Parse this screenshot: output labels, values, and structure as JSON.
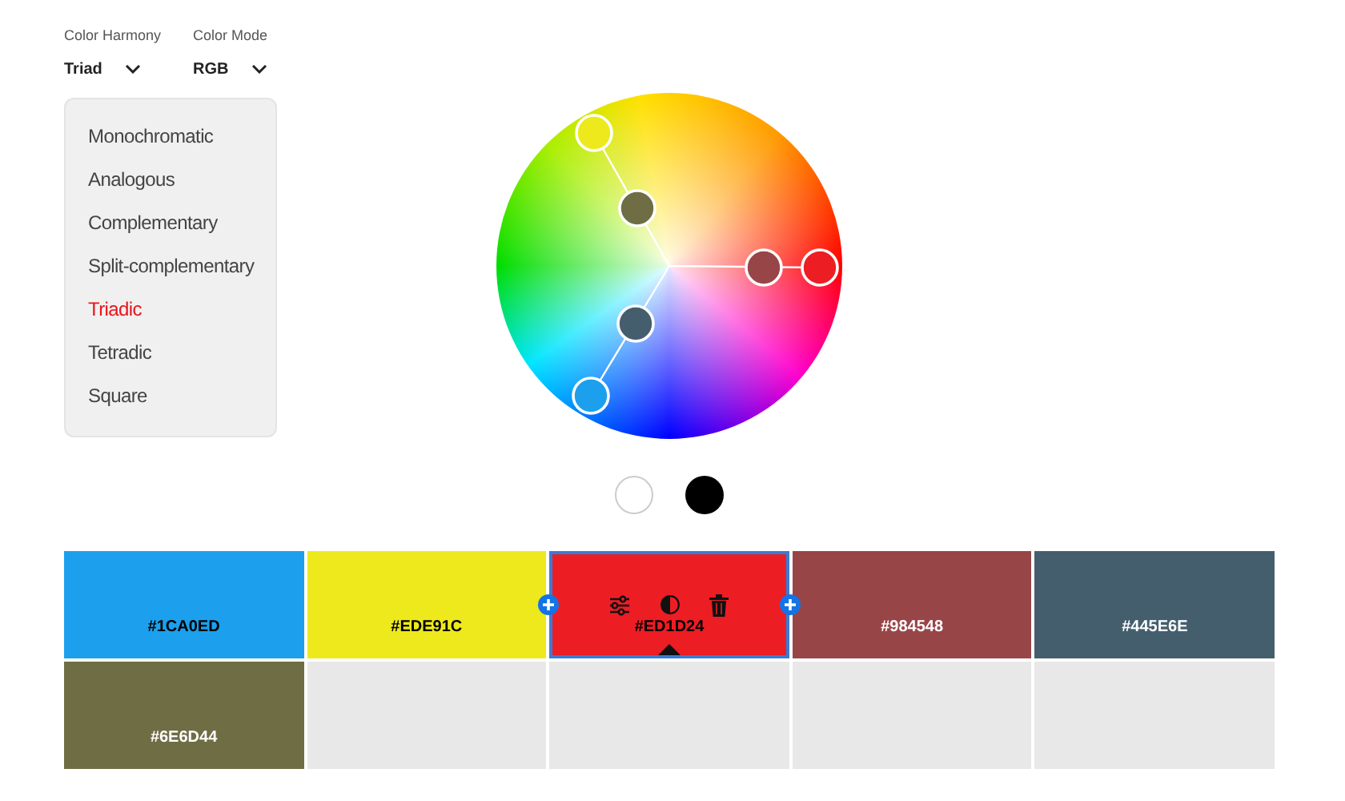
{
  "dropdowns": [
    {
      "label": "Color Harmony",
      "value": "Triad"
    },
    {
      "label": "Color Mode",
      "value": "RGB"
    }
  ],
  "harmony_menu": [
    {
      "label": "Monochromatic",
      "selected": false
    },
    {
      "label": "Analogous",
      "selected": false
    },
    {
      "label": "Complementary",
      "selected": false
    },
    {
      "label": "Split-complementary",
      "selected": false
    },
    {
      "label": "Triadic",
      "selected": true
    },
    {
      "label": "Tetradic",
      "selected": false
    },
    {
      "label": "Square",
      "selected": false
    }
  ],
  "swatches": [
    {
      "kind": "color",
      "color": "#1ca0ed",
      "hex": "#1CA0ED",
      "light_label": false,
      "selected": false
    },
    {
      "kind": "color",
      "color": "#ede91c",
      "hex": "#EDE91C",
      "light_label": false,
      "selected": false
    },
    {
      "kind": "color",
      "color": "#ed1d24",
      "hex": "#ED1D24",
      "light_label": false,
      "selected": true
    },
    {
      "kind": "color",
      "color": "#984548",
      "hex": "#984548",
      "light_label": true,
      "selected": false
    },
    {
      "kind": "color",
      "color": "#445e6e",
      "hex": "#445E6E",
      "light_label": true,
      "selected": false
    },
    {
      "kind": "color",
      "color": "#6e6d44",
      "hex": "#6E6D44",
      "light_label": true,
      "selected": false
    },
    {
      "kind": "empty"
    },
    {
      "kind": "empty"
    },
    {
      "kind": "empty"
    },
    {
      "kind": "empty"
    }
  ]
}
